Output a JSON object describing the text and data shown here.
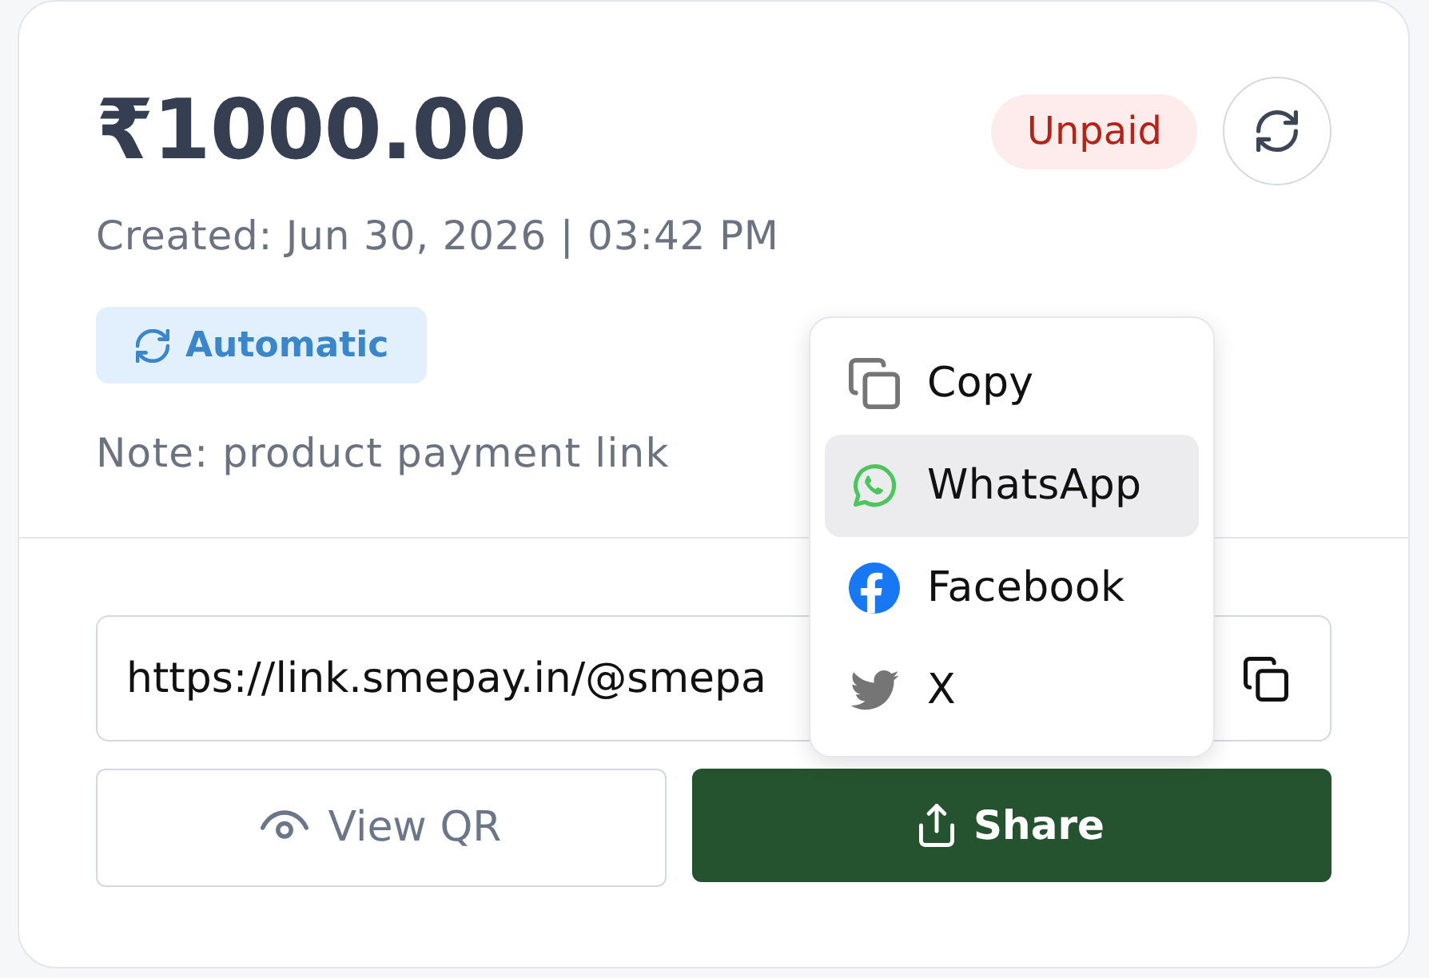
{
  "payment": {
    "amount": "₹1000.00",
    "status": {
      "label": "Unpaid",
      "kind": "unpaid"
    },
    "created": "Created: Jun 30, 2026 | 03:42 PM",
    "mode": {
      "label": "Automatic"
    },
    "note": "Note: product payment link"
  },
  "link": {
    "value": "https://link.smepay.in/@smepa"
  },
  "buttons": [
    {
      "label": "View QR",
      "kind": "secondary"
    },
    {
      "label": "Share",
      "kind": "primary"
    }
  ],
  "share_menu": {
    "items": [
      {
        "label": "Copy",
        "kind": "copy",
        "selected": false
      },
      {
        "label": "WhatsApp",
        "kind": "whatsapp",
        "selected": true
      },
      {
        "label": "Facebook",
        "kind": "facebook",
        "selected": false
      },
      {
        "label": "X",
        "kind": "x",
        "selected": false
      }
    ]
  }
}
